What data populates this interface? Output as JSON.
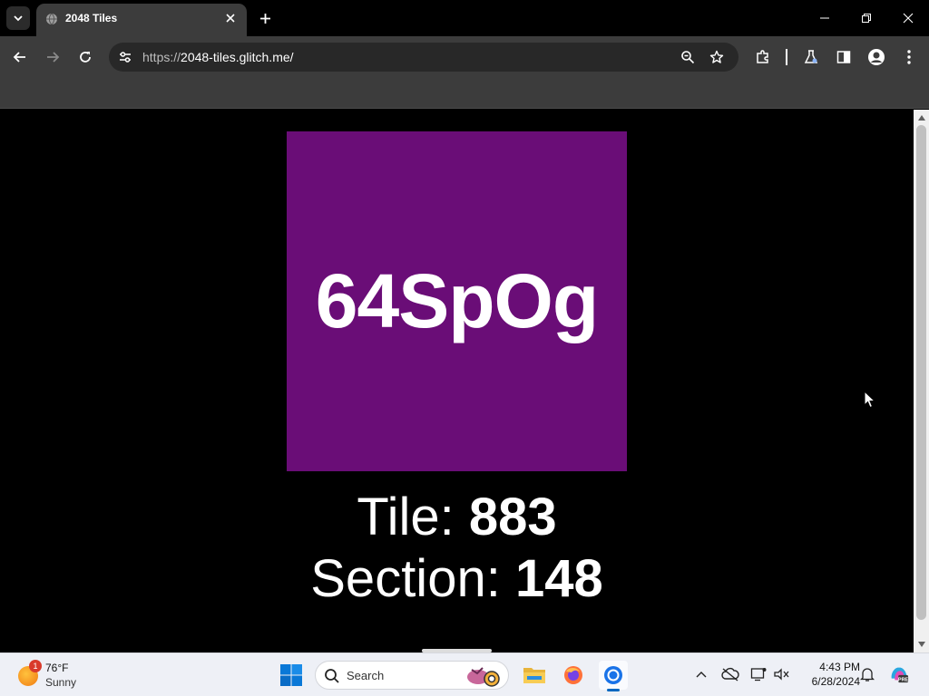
{
  "browser": {
    "tab": {
      "title": "2048 Tiles"
    },
    "url": {
      "scheme": "https://",
      "host": "2048-tiles.glitch.me/"
    }
  },
  "page": {
    "tile": {
      "label": "64SpOg",
      "color": "#6a0d77"
    },
    "tile_info": {
      "tile_label": "Tile:",
      "tile_value": "883"
    },
    "section_info": {
      "section_label": "Section:",
      "section_value": "148"
    }
  },
  "taskbar": {
    "weather": {
      "badge": "1",
      "temp": "76°F",
      "condition": "Sunny"
    },
    "search_label": "Search",
    "pinned_apps": [
      "file-explorer",
      "firefox",
      "chrome"
    ],
    "clock": {
      "time": "4:43 PM",
      "date": "6/28/2024"
    }
  }
}
